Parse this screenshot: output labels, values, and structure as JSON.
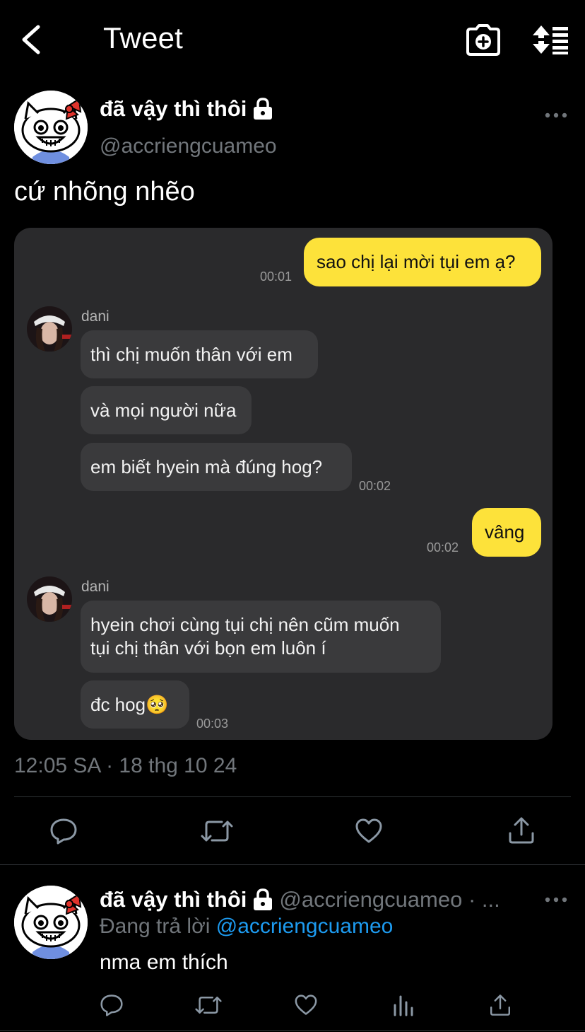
{
  "header": {
    "title": "Tweet",
    "back_icon": "chevron-left-icon",
    "camera_icon": "camera-plus-icon",
    "sort_icon": "sort-replies-icon"
  },
  "tweet": {
    "author_name": "đã vậy thì thôi",
    "handle": "@accriengcuameo",
    "text": "cứ nhõng nhẽo",
    "timestamp": "12:05 SA · 18 thg 10 24",
    "lock_icon": "lock-icon",
    "more_icon": "more-horizontal-icon"
  },
  "chat": {
    "messages": [
      {
        "side": "me",
        "text": "sao chị lại mời tụi em ạ?",
        "time": "00:01"
      },
      {
        "side": "them",
        "sender": "dani",
        "text": "thì chị muốn thân với em"
      },
      {
        "side": "them",
        "text": "và mọi người nữa"
      },
      {
        "side": "them",
        "text": "em biết hyein mà đúng hog?",
        "time": "00:02"
      },
      {
        "side": "me",
        "text": "vâng",
        "time": "00:02"
      },
      {
        "side": "them",
        "sender": "dani",
        "text_line1": "hyein chơi cùng tụi chị nên cũm muốn",
        "text_line2": "tụi chị thân với bọn em luôn í"
      },
      {
        "side": "them",
        "text": "đc hog🥺",
        "time": "00:03"
      }
    ],
    "colors": {
      "card": "#2a2a2c",
      "my_bubble": "#fde23a",
      "their_bubble": "#3a3a3c"
    }
  },
  "actions": {
    "reply_icon": "comment-icon",
    "retweet_icon": "retweet-icon",
    "like_icon": "heart-icon",
    "share_icon": "share-icon",
    "views_icon": "bar-chart-icon"
  },
  "reply": {
    "author_name": "đã vậy thì thôi",
    "handle_meta": "@accriengcuameo · ...",
    "replying_prefix": "Đang trả lời",
    "replying_to": "@accriengcuameo",
    "text": "nma em thích"
  },
  "colors": {
    "background": "#000000",
    "muted": "#71767b",
    "link": "#1d9bf0"
  }
}
